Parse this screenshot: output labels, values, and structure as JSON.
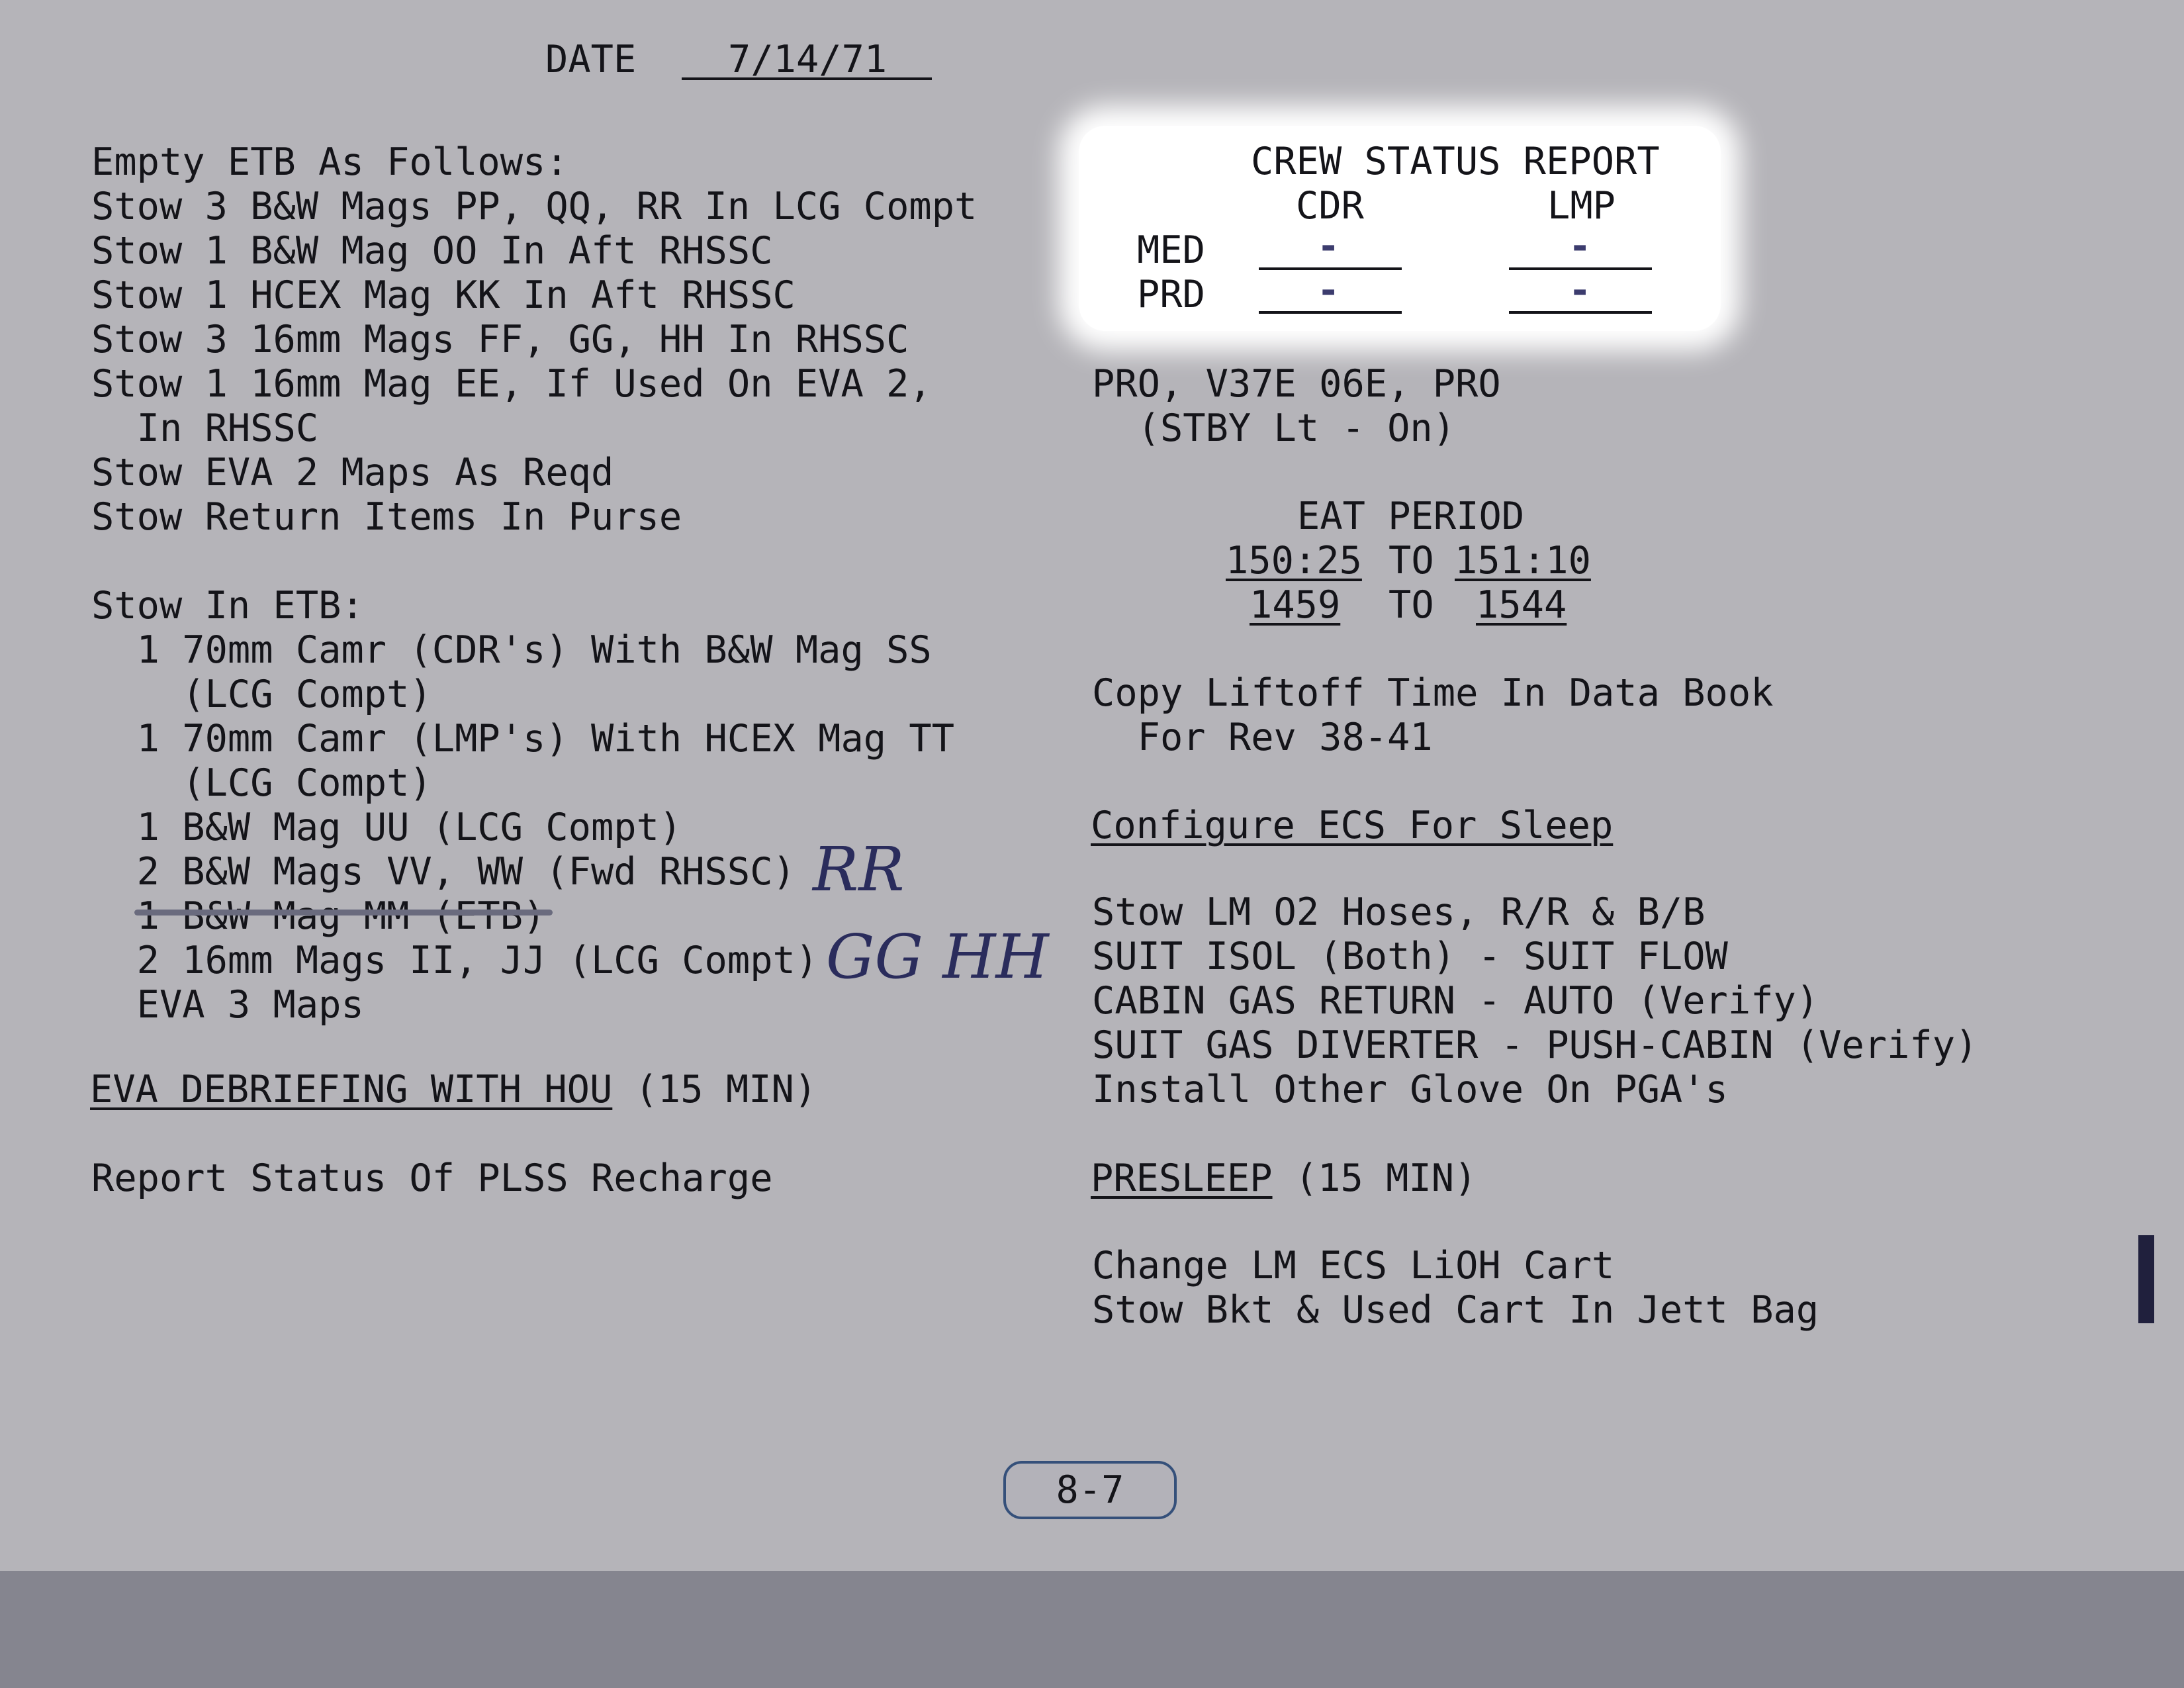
{
  "header": {
    "date_label": "DATE",
    "date_value": "7/14/71"
  },
  "left": {
    "lines": [
      "Empty ETB As Follows:",
      "Stow 3 B&W Mags PP, QQ, RR In LCG Compt",
      "Stow 1 B&W Mag OO In Aft RHSSC",
      "Stow 1 HCEX Mag KK In Aft RHSSC",
      "Stow 3 16mm Mags FF, GG, HH In RHSSC",
      "Stow 1 16mm Mag EE, If Used On EVA 2,",
      "  In RHSSC",
      "Stow EVA 2 Maps As Reqd",
      "Stow Return Items In Purse",
      "",
      "Stow In ETB:",
      "  1 70mm Camr (CDR's) With B&W Mag SS",
      "    (LCG Compt)",
      "  1 70mm Camr (LMP's) With HCEX Mag TT",
      "    (LCG Compt)",
      "  1 B&W Mag UU (LCG Compt)",
      "  2 B&W Mags VV, WW (Fwd RHSSC)",
      "  1 B&W Mag MM (ETB)",
      "  2 16mm Mags II, JJ (LCG Compt)",
      "  EVA 3 Maps"
    ],
    "debrief_heading": "EVA DEBRIEFING WITH HOU",
    "debrief_duration": " (15 MIN)",
    "plss_line": "Report Status Of PLSS Recharge"
  },
  "annotations": {
    "rr": "RR",
    "gghh": "GG HH"
  },
  "crew_status": {
    "title": "CREW STATUS REPORT",
    "col_cdr": "CDR",
    "col_lmp": "LMP",
    "row_med": "MED",
    "row_prd": "PRD",
    "med_cdr": "-",
    "med_lmp": "-",
    "prd_cdr": "-",
    "prd_lmp": "-"
  },
  "right": {
    "pro_line": "PRO, V37E 06E, PRO",
    "stby_line": "  (STBY Lt - On)",
    "eat_title": "EAT PERIOD",
    "get_start": "150:25",
    "get_end": "151:10",
    "cdt_start": "1459",
    "cdt_end": "1544",
    "to": "TO",
    "liftoff_line1": "Copy Liftoff Time In Data Book",
    "liftoff_line2": "  For Rev 38-41",
    "ecs_heading": "Configure ECS For Sleep",
    "ecs_lines": [
      "Stow LM O2 Hoses, R/R & B/B",
      "SUIT ISOL (Both) - SUIT FLOW",
      "CABIN GAS RETURN - AUTO (Verify)",
      "SUIT GAS DIVERTER - PUSH-CABIN (Verify)",
      "Install Other Glove On PGA's"
    ],
    "presleep_heading": "PRESLEEP",
    "presleep_duration": " (15 MIN)",
    "lioh_lines": [
      "Change LM ECS LiOH Cart",
      "Stow Bkt & Used Cart In Jett Bag"
    ]
  },
  "footer": {
    "page_number": "8-7"
  }
}
